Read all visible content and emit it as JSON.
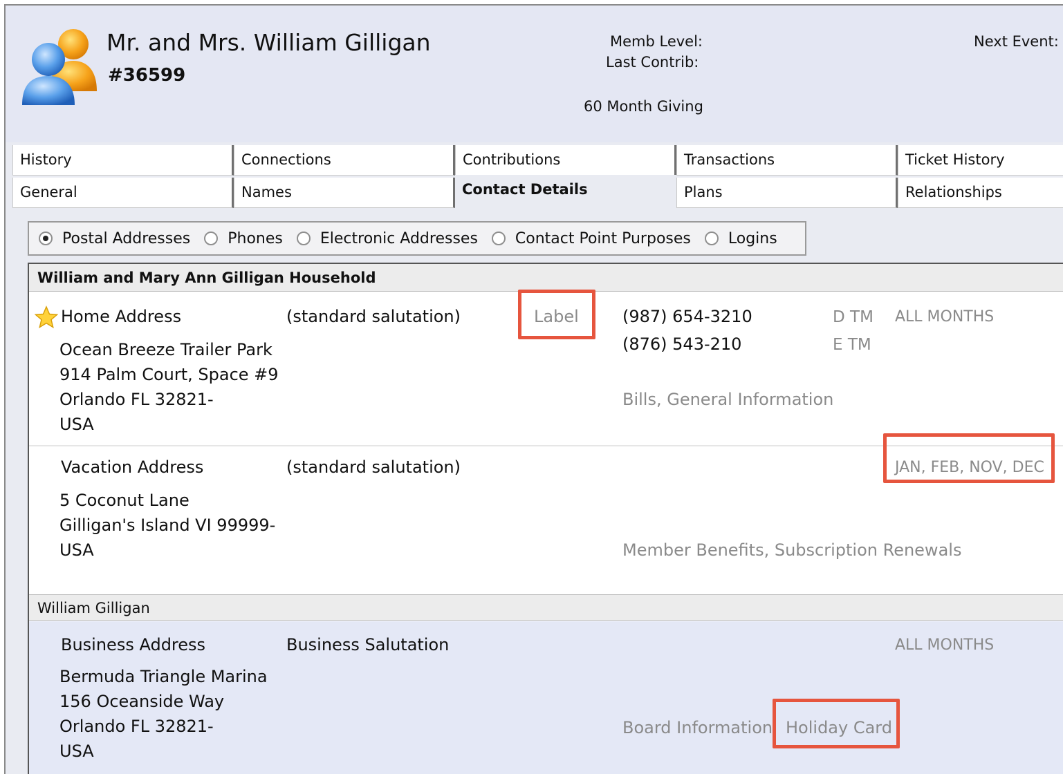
{
  "header": {
    "customer_name": "Mr. and Mrs. William Gilligan",
    "customer_id": "#36599",
    "memb_level_label": "Memb Level:",
    "last_contrib_label": "Last Contrib:",
    "giving_label": "60 Month Giving",
    "next_event_label": "Next Event:"
  },
  "tabs_row1": [
    "History",
    "Connections",
    "Contributions",
    "Transactions",
    "Ticket History"
  ],
  "tabs_row2": [
    "General",
    "Names",
    "Contact Details",
    "Plans",
    "Relationships"
  ],
  "active_tab": "Contact Details",
  "view_options": {
    "selected": "Postal Addresses",
    "items": [
      "Postal Addresses",
      "Phones",
      "Electronic Addresses",
      "Contact Point Purposes",
      "Logins"
    ]
  },
  "groups": [
    {
      "title": "William and Mary Ann Gilligan Household",
      "addresses": [
        {
          "type": "Home Address",
          "primary": true,
          "salutation": "(standard salutation)",
          "label": "Label",
          "lines": [
            "Ocean Breeze Trailer Park",
            "914 Palm Court, Space #9",
            "Orlando  FL  32821-",
            "USA"
          ],
          "phones": [
            {
              "number": "(987) 654-3210",
              "code": "D  TM"
            },
            {
              "number": "(876) 543-210",
              "code": "E  TM"
            }
          ],
          "months": "ALL MONTHS",
          "purposes": "Bills, General Information"
        },
        {
          "type": "Vacation Address",
          "primary": false,
          "salutation": "(standard salutation)",
          "lines": [
            "5 Coconut Lane",
            "Gilligan's Island  VI  99999-",
            "USA"
          ],
          "months": "JAN, FEB, NOV, DEC",
          "purposes": "Member Benefits, Subscription Renewals"
        }
      ]
    },
    {
      "title": "William Gilligan",
      "addresses": [
        {
          "type": "Business Address",
          "primary": false,
          "salutation": "Business Salutation",
          "lines": [
            "Bermuda Triangle Marina",
            "156 Oceanside Way",
            "Orlando  FL  32821-",
            "USA"
          ],
          "months": "ALL MONTHS",
          "purposes_1": "Board Information",
          "purposes_2": "Holiday Card"
        }
      ]
    }
  ],
  "colors": {
    "highlight": "#e6553e",
    "header_bg": "#e4e7f3",
    "selected_row_bg": "#e4e8f6"
  },
  "icons": [
    "customer-avatar-icon",
    "primary-star-icon"
  ]
}
